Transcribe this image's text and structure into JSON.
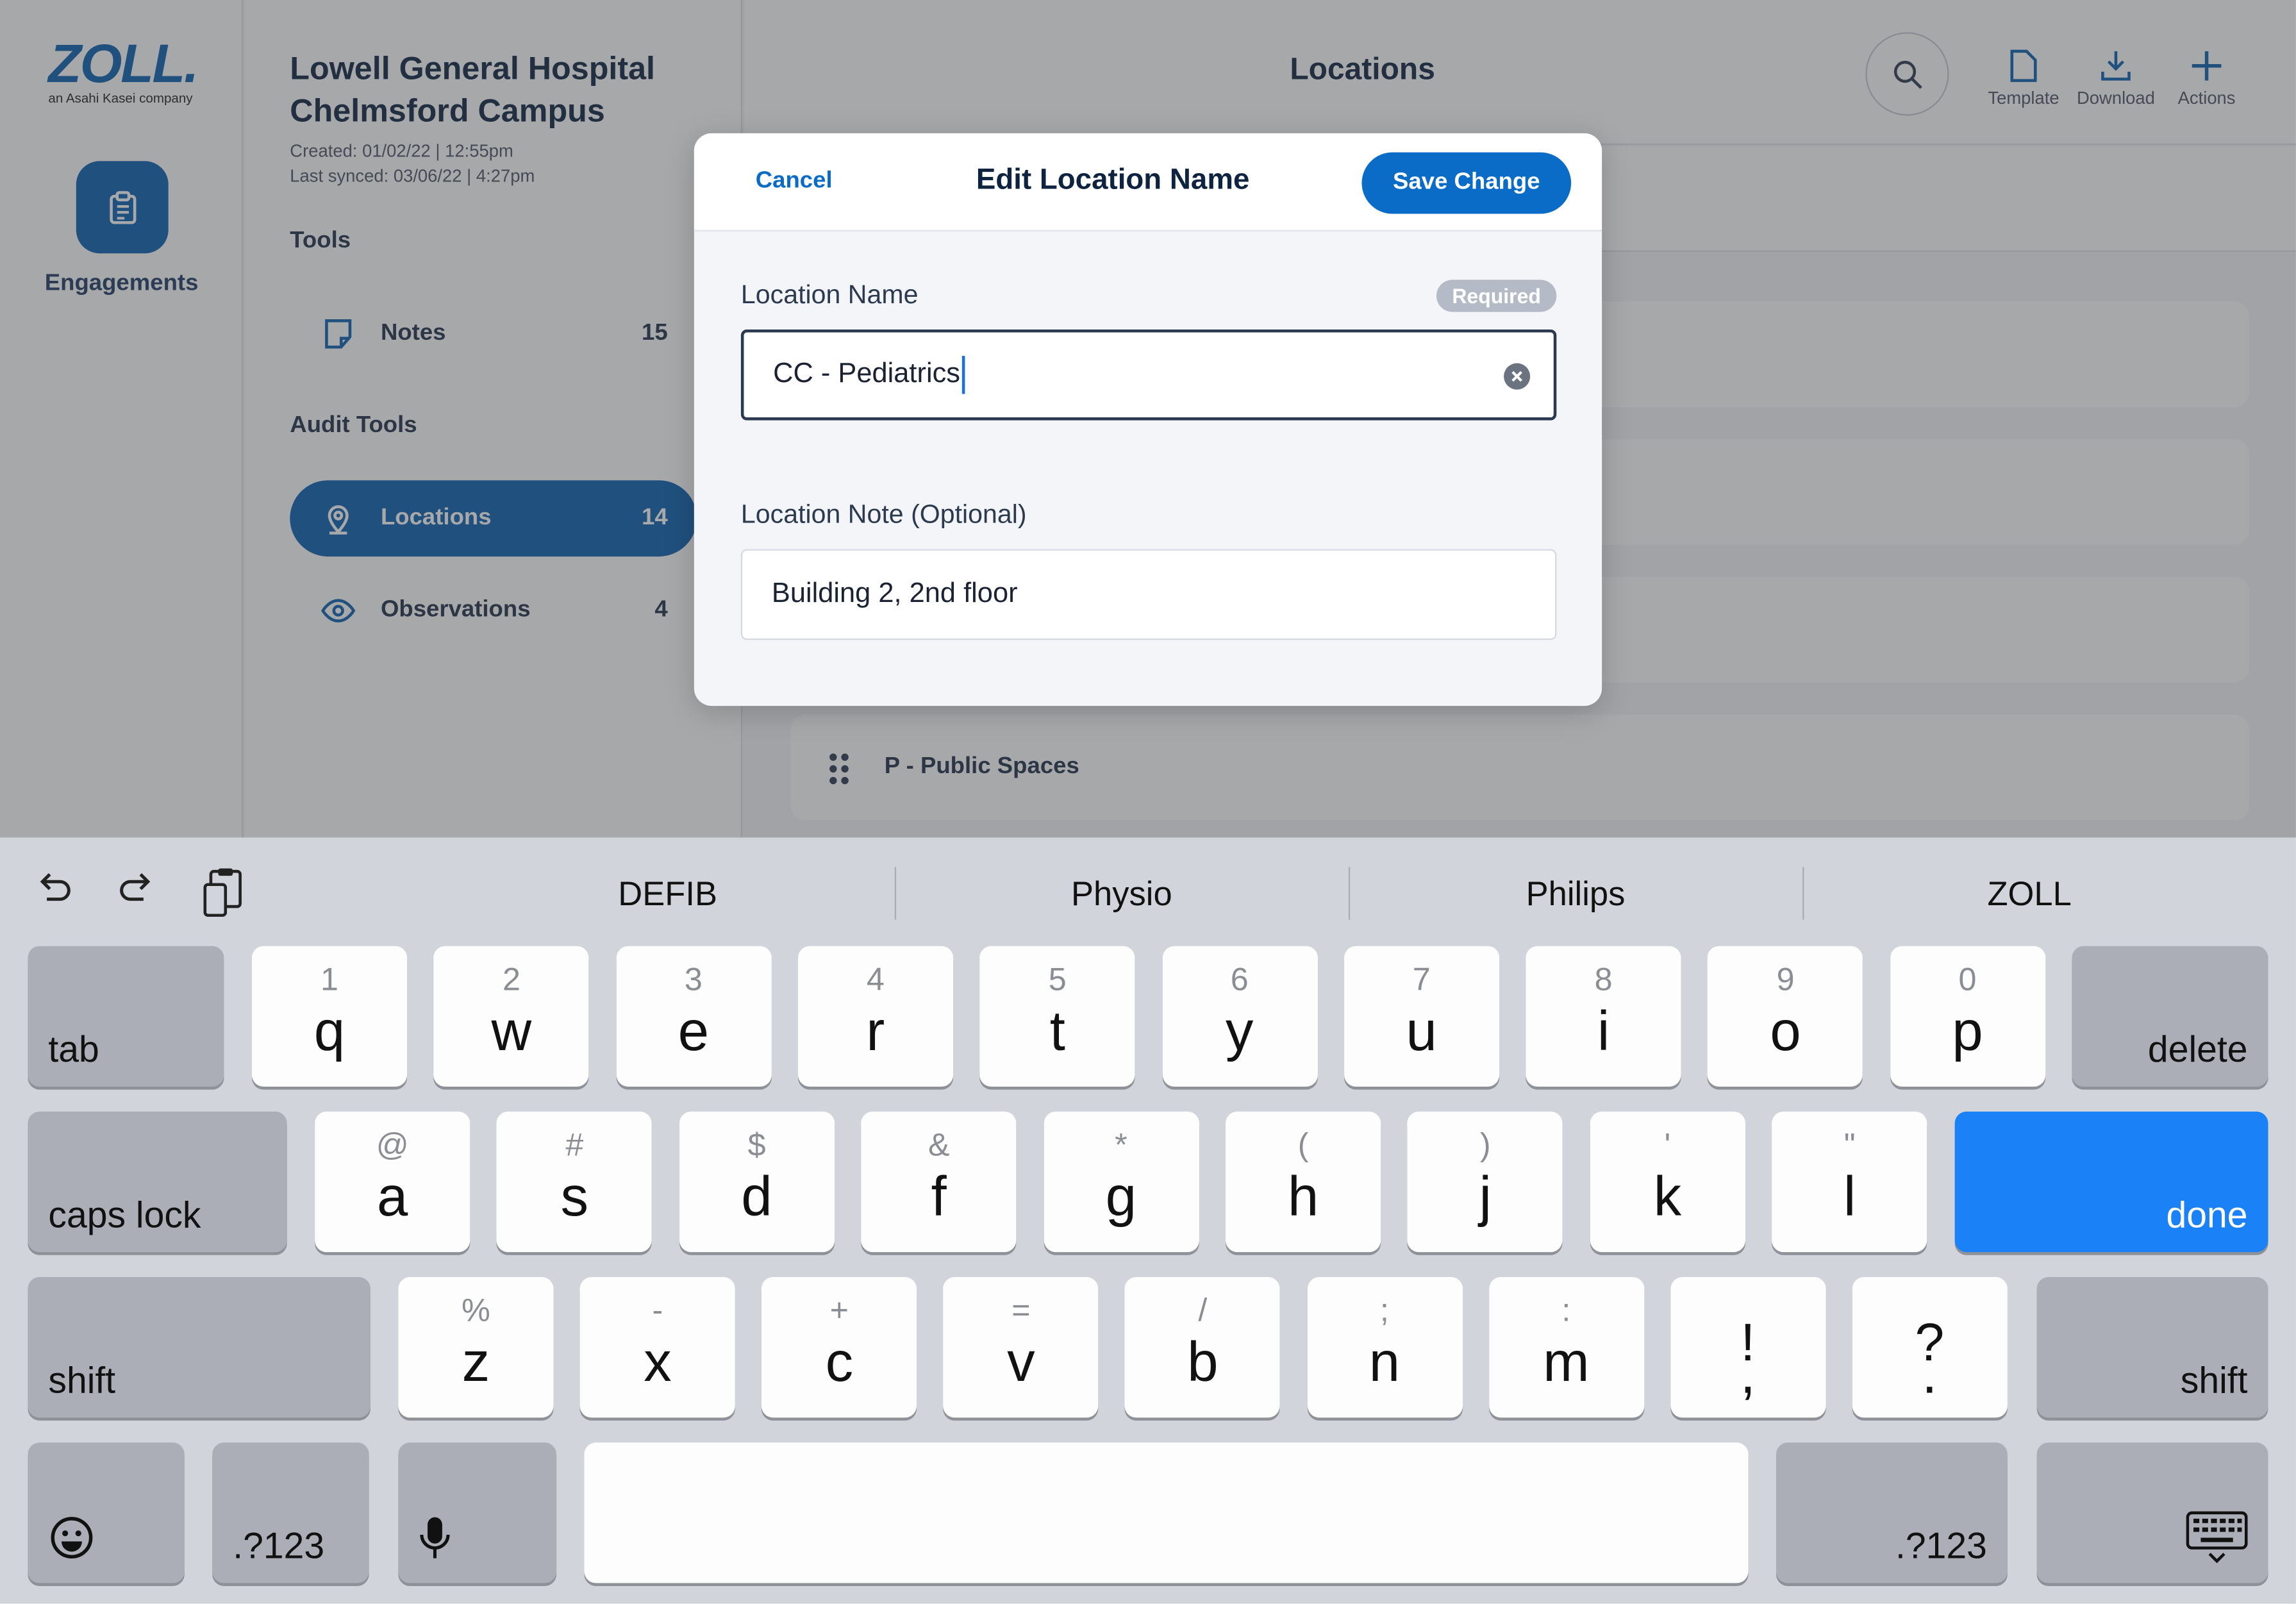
{
  "brand": {
    "logo_text": "ZOLL.",
    "logo_sub": "an Asahi Kasei company"
  },
  "rail": {
    "engagements_label": "Engagements"
  },
  "project": {
    "title_line1": "Lowell General Hospital",
    "title_line2": "Chelmsford Campus",
    "created": "Created: 01/02/22 | 12:55pm",
    "synced": "Last synced: 03/06/22 | 4:27pm"
  },
  "tools": {
    "heading": "Tools",
    "notes_label": "Notes",
    "notes_count": "15"
  },
  "audit_tools": {
    "heading": "Audit Tools",
    "locations_label": "Locations",
    "locations_count": "14",
    "observations_label": "Observations",
    "observations_count": "4"
  },
  "header": {
    "title": "Locations",
    "template_label": "Template",
    "download_label": "Download",
    "actions_label": "Actions"
  },
  "list": {
    "visible_row": "P - Public Spaces"
  },
  "modal": {
    "cancel": "Cancel",
    "title": "Edit Location Name",
    "save": "Save Change",
    "name_label": "Location Name",
    "required": "Required",
    "name_value": "CC - Pediatrics",
    "note_label": "Location Note (Optional)",
    "note_value": "Building 2, 2nd floor"
  },
  "keyboard": {
    "suggestions": [
      "DEFIB",
      "Physio",
      "Philips",
      "ZOLL"
    ],
    "row1": [
      {
        "sec": "1",
        "pri": "q"
      },
      {
        "sec": "2",
        "pri": "w"
      },
      {
        "sec": "3",
        "pri": "e"
      },
      {
        "sec": "4",
        "pri": "r"
      },
      {
        "sec": "5",
        "pri": "t"
      },
      {
        "sec": "6",
        "pri": "y"
      },
      {
        "sec": "7",
        "pri": "u"
      },
      {
        "sec": "8",
        "pri": "i"
      },
      {
        "sec": "9",
        "pri": "o"
      },
      {
        "sec": "0",
        "pri": "p"
      }
    ],
    "row2": [
      {
        "sec": "@",
        "pri": "a"
      },
      {
        "sec": "#",
        "pri": "s"
      },
      {
        "sec": "$",
        "pri": "d"
      },
      {
        "sec": "&",
        "pri": "f"
      },
      {
        "sec": "*",
        "pri": "g"
      },
      {
        "sec": "(",
        "pri": "h"
      },
      {
        "sec": ")",
        "pri": "j"
      },
      {
        "sec": "'",
        "pri": "k"
      },
      {
        "sec": "\"",
        "pri": "l"
      }
    ],
    "row3": [
      {
        "sec": "%",
        "pri": "z"
      },
      {
        "sec": "-",
        "pri": "x"
      },
      {
        "sec": "+",
        "pri": "c"
      },
      {
        "sec": "=",
        "pri": "v"
      },
      {
        "sec": "/",
        "pri": "b"
      },
      {
        "sec": ";",
        "pri": "n"
      },
      {
        "sec": ":",
        "pri": "m"
      },
      {
        "sec": "!",
        "pri": ","
      },
      {
        "sec": "?",
        "pri": "."
      }
    ],
    "tab": "tab",
    "delete": "delete",
    "caps_lock": "caps lock",
    "done": "done",
    "shift": "shift",
    "numbers": ".?123",
    "done_color": "#1a82f6"
  },
  "colors": {
    "primary": "#0a5fb0",
    "accent": "#0a6cc6"
  }
}
